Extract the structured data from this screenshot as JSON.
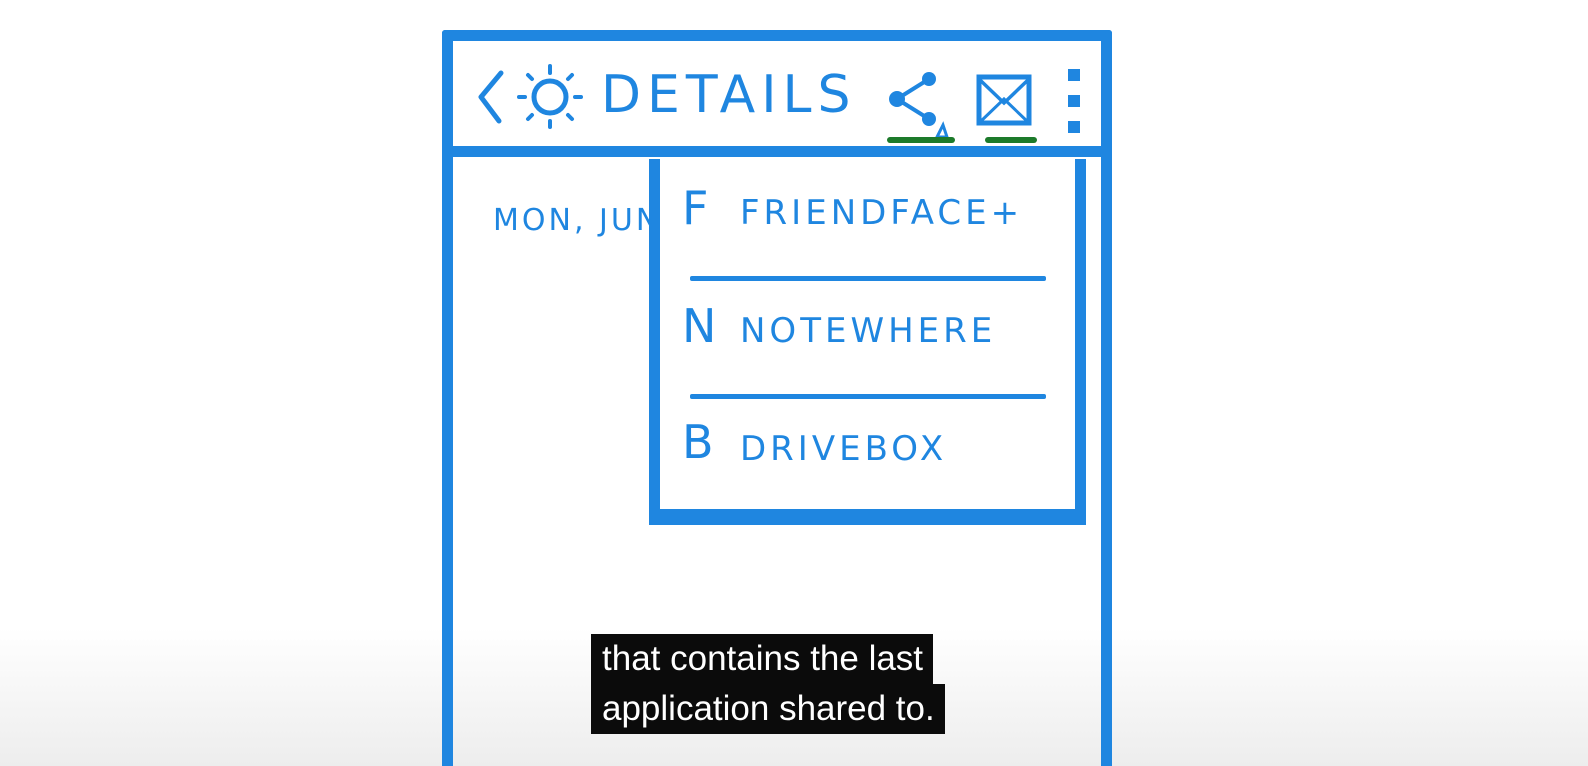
{
  "appbar": {
    "title": "DETAILS",
    "icons": [
      "back-icon",
      "sun-icon",
      "share-icon",
      "mail-icon",
      "more-vert-icon"
    ]
  },
  "content": {
    "date_text": "MON, JUN"
  },
  "share_menu": {
    "items": [
      {
        "letter": "F",
        "label": "FRIENDFACE+"
      },
      {
        "letter": "N",
        "label": "NOTEWHERE"
      },
      {
        "letter": "B",
        "label": "DRIVEBOX"
      }
    ]
  },
  "captions": {
    "line1": "that contains the last",
    "line2": "application shared to."
  },
  "colors": {
    "sketch_blue": "#1f86e0",
    "highlight_green": "#1c7a2a",
    "caption_bg": "#0b0b0b",
    "caption_text": "#ffffff"
  }
}
